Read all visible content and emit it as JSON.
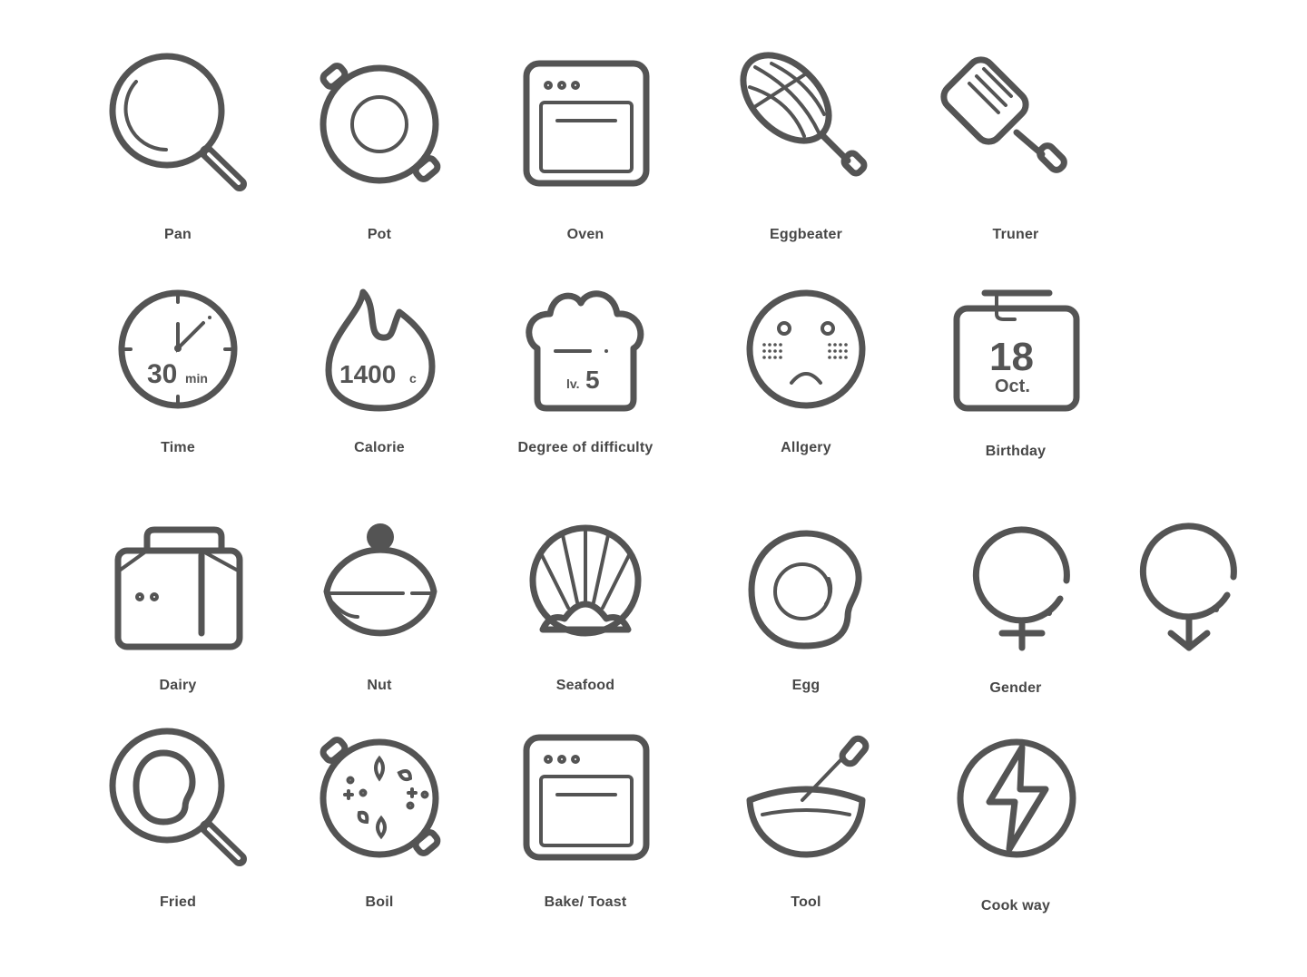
{
  "icon_color": "#545454",
  "icons": [
    {
      "label": "Pan",
      "icon": "pan-icon"
    },
    {
      "label": "Pot",
      "icon": "pot-icon"
    },
    {
      "label": "Oven",
      "icon": "oven-icon"
    },
    {
      "label": "Eggbeater",
      "icon": "eggbeater-icon"
    },
    {
      "label": "Truner",
      "icon": "turner-icon"
    },
    {
      "label": "Time",
      "icon": "timer-icon"
    },
    {
      "label": "Calorie",
      "icon": "flame-icon"
    },
    {
      "label": "Degree of difficulty",
      "icon": "chef-hat-icon"
    },
    {
      "label": "Allgery",
      "icon": "sad-face-icon"
    },
    {
      "label": "Birthday",
      "icon": "calendar-icon"
    },
    {
      "label": "Dairy",
      "icon": "milk-carton-icon"
    },
    {
      "label": "Nut",
      "icon": "nut-icon"
    },
    {
      "label": "Seafood",
      "icon": "shell-icon"
    },
    {
      "label": "Egg",
      "icon": "egg-icon"
    },
    {
      "label": "Gender",
      "icon": "gender-icon"
    },
    {
      "label": "Fried",
      "icon": "fried-egg-pan-icon"
    },
    {
      "label": "Boil",
      "icon": "boil-pot-icon"
    },
    {
      "label": "Bake/ Toast",
      "icon": "bake-oven-icon"
    },
    {
      "label": "Tool",
      "icon": "bowl-whisk-icon"
    },
    {
      "label": "Cook way",
      "icon": "lightning-icon"
    }
  ],
  "icon_text": {
    "time_value": "30",
    "time_unit": "min",
    "calorie_value": "1400",
    "calorie_unit": "c",
    "level_prefix": "lv.",
    "level_value": "5",
    "birthday_day": "18",
    "birthday_month": "Oct."
  }
}
